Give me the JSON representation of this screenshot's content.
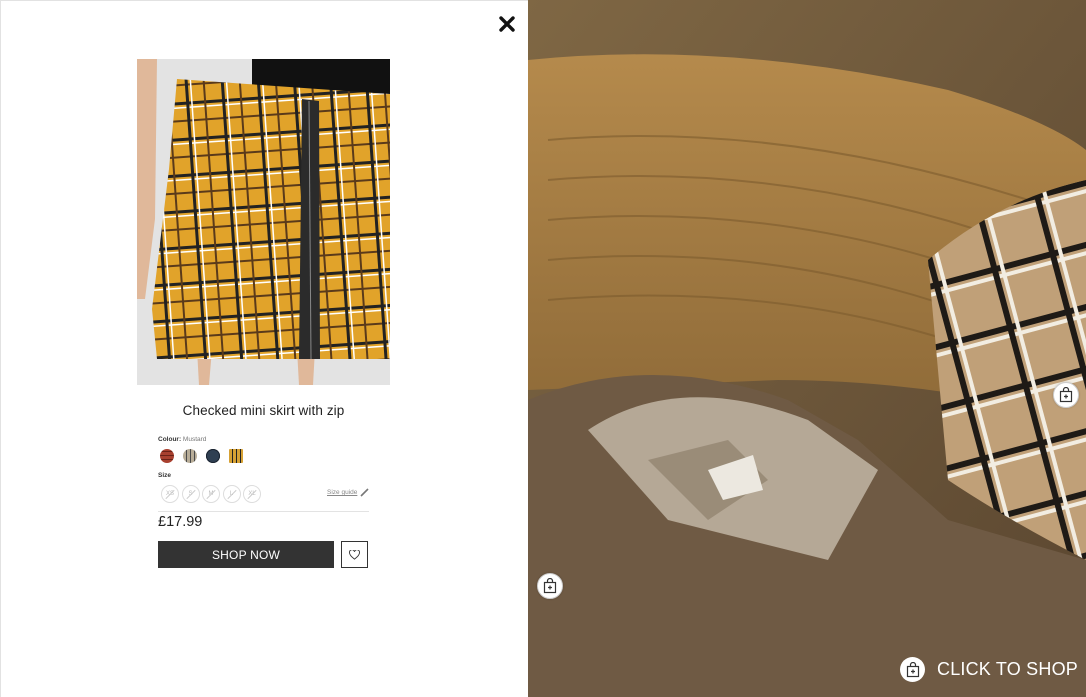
{
  "product": {
    "title": "Checked mini skirt with zip",
    "colour_label": "Colour:",
    "colour_value": "Mustard",
    "colours": [
      {
        "name": "red-check",
        "color": "#a8402f"
      },
      {
        "name": "grey-check",
        "color": "#a49a88"
      },
      {
        "name": "navy-check",
        "color": "#2f3f52"
      },
      {
        "name": "mustard-check",
        "color": "#c99a2e"
      }
    ],
    "size_label": "Size",
    "sizes": [
      "XS",
      "S",
      "M",
      "L",
      "XL"
    ],
    "size_guide": "Size guide",
    "price": "£17.99",
    "shop_now": "SHOP NOW"
  },
  "scene": {
    "cta": "CLICK TO SHOP"
  },
  "colors": {
    "button_bg": "#333333",
    "accent_mustard": "#e0a52d"
  }
}
